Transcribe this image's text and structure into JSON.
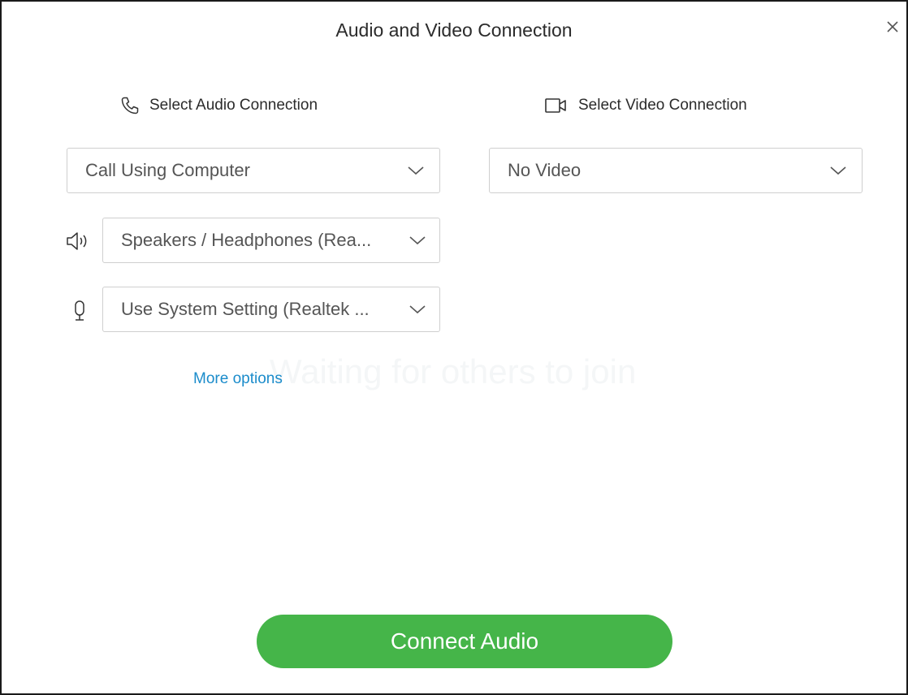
{
  "dialog": {
    "title": "Audio and Video Connection"
  },
  "audio": {
    "heading": "Select Audio Connection",
    "connection_value": "Call Using Computer",
    "speaker_value": "Speakers / Headphones (Rea...",
    "microphone_value": "Use System Setting (Realtek ..."
  },
  "video": {
    "heading": "Select Video Connection",
    "connection_value": "No Video"
  },
  "more_options_label": "More options",
  "background_text": "Waiting for others to join",
  "connect_button_label": "Connect Audio",
  "colors": {
    "accent_green": "#45b549",
    "link_blue": "#1b8ccb",
    "border": "#cfcfcf"
  },
  "icons": [
    "close-icon",
    "phone-icon",
    "video-camera-icon",
    "speaker-icon",
    "microphone-icon",
    "chevron-down-icon"
  ]
}
